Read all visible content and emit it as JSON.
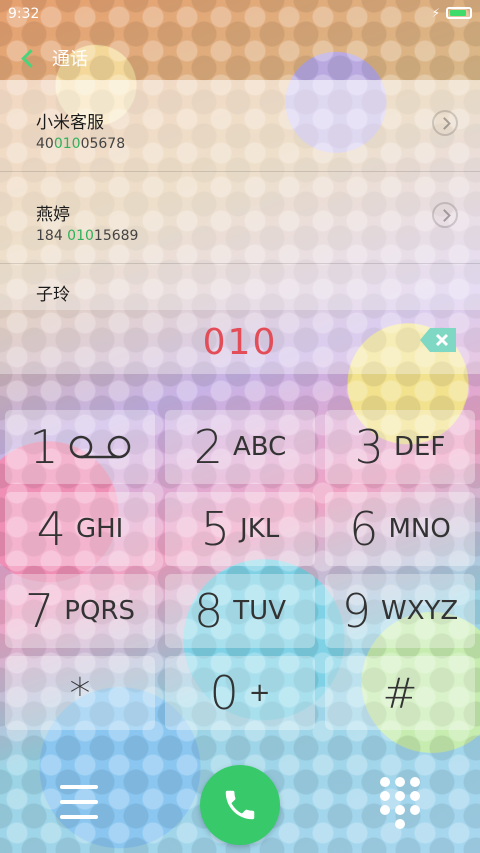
{
  "status_bar": {
    "time": "9:32"
  },
  "header": {
    "title": "通话"
  },
  "contacts": [
    {
      "name": "小米客服",
      "number_pre": "40",
      "number_match": "010",
      "number_post": "05678"
    },
    {
      "name": "燕婷",
      "number_pre": "184 ",
      "number_match": "010",
      "number_post": "15689"
    },
    {
      "name": "子玲",
      "number_pre": "",
      "number_match": "",
      "number_post": ""
    }
  ],
  "dialer": {
    "entered_number": "010"
  },
  "keypad": {
    "k1": {
      "digit": "1",
      "letters": ""
    },
    "k2": {
      "digit": "2",
      "letters": "ABC"
    },
    "k3": {
      "digit": "3",
      "letters": "DEF"
    },
    "k4": {
      "digit": "4",
      "letters": "GHI"
    },
    "k5": {
      "digit": "5",
      "letters": "JKL"
    },
    "k6": {
      "digit": "6",
      "letters": "MNO"
    },
    "k7": {
      "digit": "7",
      "letters": "PQRS"
    },
    "k8": {
      "digit": "8",
      "letters": "TUV"
    },
    "k9": {
      "digit": "9",
      "letters": "WXYZ"
    },
    "star": {
      "symbol": "*"
    },
    "k0": {
      "digit": "0",
      "letters": "+"
    },
    "hash": {
      "symbol": "#"
    }
  },
  "colors": {
    "accent_green": "#37c96a",
    "dial_red": "#e34d58"
  },
  "icons": [
    "back-icon",
    "chevron-right-icon",
    "backspace-icon",
    "voicemail-icon",
    "menu-icon",
    "phone-icon",
    "dialpad-icon"
  ]
}
